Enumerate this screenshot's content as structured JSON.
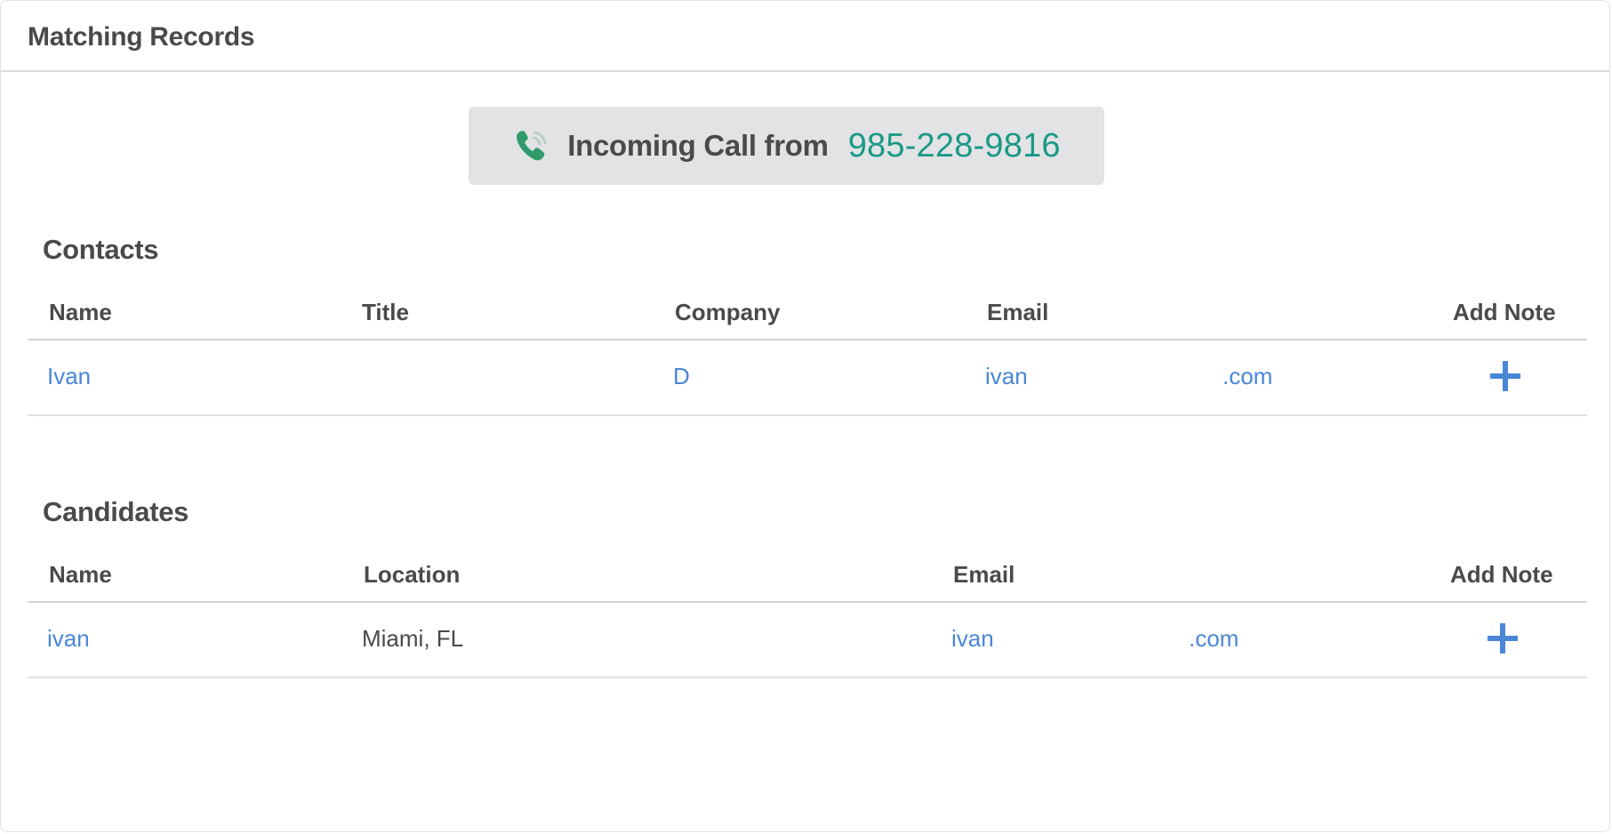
{
  "header": {
    "title": "Matching Records"
  },
  "call_banner": {
    "label": "Incoming Call from",
    "phone_number": "985-228-9816",
    "icon": "phone-ringing-icon",
    "number_color": "#1a9a86"
  },
  "contacts": {
    "title": "Contacts",
    "columns": [
      "Name",
      "Title",
      "Company",
      "Email",
      "Add Note"
    ],
    "rows": [
      {
        "name": "Ivan",
        "title": "",
        "company": "D",
        "email_user": "ivan",
        "email_domain": ".com",
        "add_note_icon": "plus-icon"
      }
    ]
  },
  "candidates": {
    "title": "Candidates",
    "columns": [
      "Name",
      "Location",
      "Email",
      "Add Note"
    ],
    "rows": [
      {
        "name": "ivan",
        "location": "Miami, FL",
        "email_user": "ivan",
        "email_domain": ".com",
        "add_note_icon": "plus-icon"
      }
    ]
  },
  "colors": {
    "link": "#4a86d6",
    "text": "#4a4a4a",
    "banner_bg": "#e2e3e5",
    "accent_green": "#1a9a86"
  }
}
